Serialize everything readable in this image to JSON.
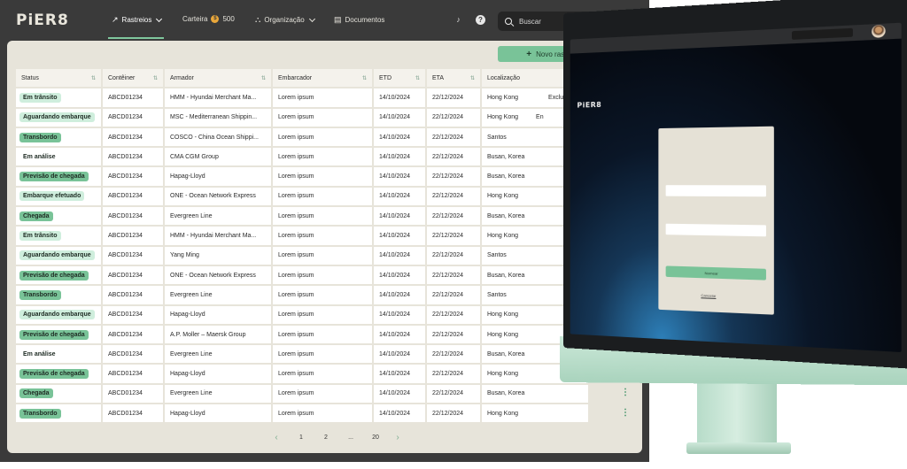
{
  "app": {
    "logo": "PiER8",
    "nav": [
      {
        "label": "Rastreios",
        "icon": "route-icon",
        "active": true
      },
      {
        "label": "Carteira",
        "icon": "coin-icon",
        "badge_symbol": "$",
        "badge": "500"
      },
      {
        "label": "Organização",
        "icon": "organization-icon"
      },
      {
        "label": "Documentos",
        "icon": "document-icon"
      }
    ],
    "search_placeholder": "Buscar",
    "accent_color": "#79c398"
  },
  "toolbar": {
    "new_tracking": "Novo rastreio",
    "new_tracking_icon": "plus-icon",
    "export_icon": "download-icon"
  },
  "table": {
    "columns": [
      "Status",
      "Contêiner",
      "Armador",
      "Embarcador",
      "ETD",
      "ETA",
      "Localização"
    ],
    "rows": [
      {
        "status": "Em trânsito",
        "tone": "light",
        "container": "ABCD01234",
        "carrier": "HMM - Hyundai Merchant Ma...",
        "shipper": "Lorem ipsum",
        "etd": "14/10/2024",
        "eta": "22/12/2024",
        "location": "Hong Kong",
        "extra": "Exclu"
      },
      {
        "status": "Aguardando embarque",
        "tone": "light",
        "container": "ABCD01234",
        "carrier": "MSC - Mediterranean Shippin...",
        "shipper": "Lorem ipsum",
        "etd": "14/10/2024",
        "eta": "22/12/2024",
        "location": "Hong Kong",
        "extra": "En"
      },
      {
        "status": "Transbordo",
        "tone": "mid",
        "container": "ABCD01234",
        "carrier": "COSCO - China Ocean Shippi...",
        "shipper": "Lorem ipsum",
        "etd": "14/10/2024",
        "eta": "22/12/2024",
        "location": "Santos",
        "extra": ""
      },
      {
        "status": "Em análise",
        "tone": "plain",
        "container": "ABCD01234",
        "carrier": "CMA CGM Group",
        "shipper": "Lorem ipsum",
        "etd": "14/10/2024",
        "eta": "22/12/2024",
        "location": "Busan, Korea",
        "extra": ""
      },
      {
        "status": "Previsão de chegada",
        "tone": "mid",
        "container": "ABCD01234",
        "carrier": "Hapag-Lloyd",
        "shipper": "Lorem ipsum",
        "etd": "14/10/2024",
        "eta": "22/12/2024",
        "location": "Busan, Korea",
        "extra": ""
      },
      {
        "status": "Embarque efetuado",
        "tone": "light",
        "container": "ABCD01234",
        "carrier": "ONE - Ocean Network Express",
        "shipper": "Lorem ipsum",
        "etd": "14/10/2024",
        "eta": "22/12/2024",
        "location": "Hong Kong",
        "extra": ""
      },
      {
        "status": "Chegada",
        "tone": "mid",
        "container": "ABCD01234",
        "carrier": "Evergreen Line",
        "shipper": "Lorem ipsum",
        "etd": "14/10/2024",
        "eta": "22/12/2024",
        "location": "Busan, Korea",
        "extra": ""
      },
      {
        "status": "Em trânsito",
        "tone": "light",
        "container": "ABCD01234",
        "carrier": "HMM - Hyundai Merchant Ma...",
        "shipper": "Lorem ipsum",
        "etd": "14/10/2024",
        "eta": "22/12/2024",
        "location": "Hong Kong",
        "extra": ""
      },
      {
        "status": "Aguardando embarque",
        "tone": "light",
        "container": "ABCD01234",
        "carrier": "Yang Ming",
        "shipper": "Lorem ipsum",
        "etd": "14/10/2024",
        "eta": "22/12/2024",
        "location": "Santos",
        "extra": ""
      },
      {
        "status": "Previsão de chegada",
        "tone": "mid",
        "container": "ABCD01234",
        "carrier": "ONE - Ocean Network Express",
        "shipper": "Lorem ipsum",
        "etd": "14/10/2024",
        "eta": "22/12/2024",
        "location": "Busan, Korea",
        "extra": ""
      },
      {
        "status": "Transbordo",
        "tone": "mid",
        "container": "ABCD01234",
        "carrier": "Evergreen Line",
        "shipper": "Lorem ipsum",
        "etd": "14/10/2024",
        "eta": "22/12/2024",
        "location": "Santos",
        "extra": ""
      },
      {
        "status": "Aguardando embarque",
        "tone": "light",
        "container": "ABCD01234",
        "carrier": "Hapag-Lloyd",
        "shipper": "Lorem ipsum",
        "etd": "14/10/2024",
        "eta": "22/12/2024",
        "location": "Hong Kong",
        "extra": ""
      },
      {
        "status": "Previsão de chegada",
        "tone": "mid",
        "container": "ABCD01234",
        "carrier": "A.P. Moller – Maersk Group",
        "shipper": "Lorem ipsum",
        "etd": "14/10/2024",
        "eta": "22/12/2024",
        "location": "Hong Kong",
        "extra": ""
      },
      {
        "status": "Em análise",
        "tone": "plain",
        "container": "ABCD01234",
        "carrier": "Evergreen Line",
        "shipper": "Lorem ipsum",
        "etd": "14/10/2024",
        "eta": "22/12/2024",
        "location": "Busan, Korea",
        "extra": ""
      },
      {
        "status": "Previsão de chegada",
        "tone": "mid",
        "container": "ABCD01234",
        "carrier": "Hapag-Lloyd",
        "shipper": "Lorem ipsum",
        "etd": "14/10/2024",
        "eta": "22/12/2024",
        "location": "Hong Kong",
        "extra": ""
      },
      {
        "status": "Chegada",
        "tone": "mid",
        "container": "ABCD01234",
        "carrier": "Evergreen Line",
        "shipper": "Lorem ipsum",
        "etd": "14/10/2024",
        "eta": "22/12/2024",
        "location": "Busan, Korea",
        "extra": ""
      },
      {
        "status": "Transbordo",
        "tone": "mid",
        "container": "ABCD01234",
        "carrier": "Hapag-Lloyd",
        "shipper": "Lorem ipsum",
        "etd": "14/10/2024",
        "eta": "22/12/2024",
        "location": "Hong Kong",
        "extra": ""
      }
    ]
  },
  "pagination": {
    "prev": "‹",
    "pages": [
      "1",
      "2",
      "...",
      "20"
    ],
    "next": "›"
  },
  "monitor": {
    "logo": "PiER8",
    "modal_buttons": [
      "Nomear",
      "Cancelar"
    ]
  }
}
